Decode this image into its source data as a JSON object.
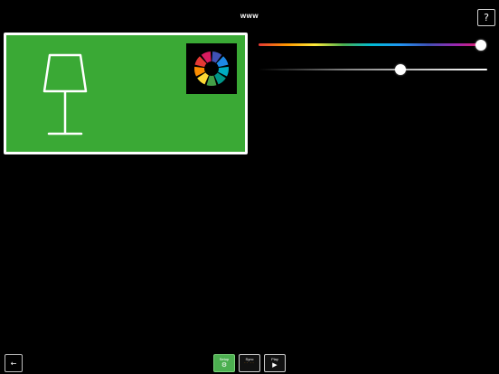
{
  "header": {
    "title": "www"
  },
  "help": {
    "label": "?"
  },
  "preview": {
    "background_color": "#3aa935",
    "icon": "table-lamp-icon",
    "wheel_icon": "color-wheel-icon"
  },
  "sliders": {
    "hue": {
      "value": 1.0
    },
    "brightness": {
      "value": 0.62
    }
  },
  "footer": {
    "back_label": "←",
    "tabs": [
      {
        "label": "Setup",
        "icon": "gear-icon",
        "glyph": "⚙",
        "active": true
      },
      {
        "label": "Sync",
        "icon": "sync-dots-icon",
        "glyph": "·· ··",
        "active": false
      },
      {
        "label": "Play",
        "icon": "play-icon",
        "glyph": "▶",
        "active": false
      }
    ]
  }
}
